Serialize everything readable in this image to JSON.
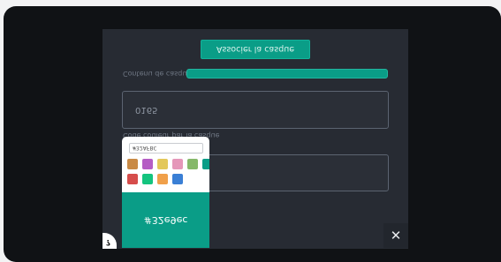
{
  "dialog": {
    "associate_button": "Associer la casque",
    "content_label": "Contenu de casque",
    "field1_value": "0165",
    "field2_label": "Code couleur par la casque",
    "close_symbol": "✕",
    "corner_badge": "?"
  },
  "color_picker": {
    "hex_value": "#32AFBC",
    "preview_label": "#32e9ec",
    "preview_color": "#0a9d87",
    "swatches": [
      "#c98a45",
      "#b55dc4",
      "#e3c85a",
      "#e597b9",
      "#86b86a",
      "#0a9d87",
      "#d64d4b",
      "#14c47e",
      "#f0a04a",
      "#3a7fd5"
    ]
  },
  "theme": {
    "accent": "#0a9d87",
    "panel": "#272b33",
    "frame": "#101215"
  },
  "progress": {
    "fill_fraction": 1.0
  }
}
